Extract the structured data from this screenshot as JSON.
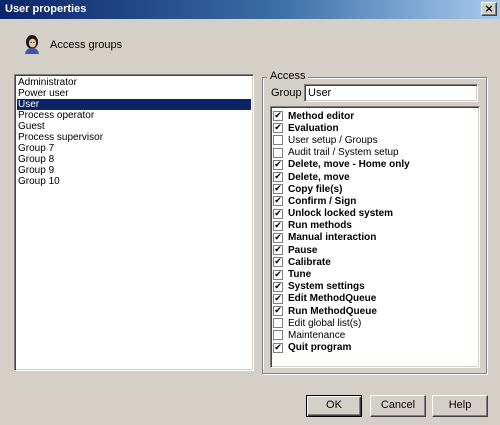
{
  "window": {
    "title": "User properties",
    "close_glyph": "×"
  },
  "header": {
    "icon": "user-icon",
    "label": "Access groups"
  },
  "groups": {
    "items": [
      "Administrator",
      "Power user",
      "User",
      "Process operator",
      "Guest",
      "Process supervisor",
      "Group 7",
      "Group 8",
      "Group 9",
      "Group 10"
    ],
    "selected": "User"
  },
  "access": {
    "legend": "Access",
    "group_label": "Group",
    "group_value": "User",
    "permissions": [
      {
        "label": "Method editor",
        "checked": true
      },
      {
        "label": "Evaluation",
        "checked": true
      },
      {
        "label": "User setup / Groups",
        "checked": false
      },
      {
        "label": "Audit trail / System setup",
        "checked": false
      },
      {
        "label": "Delete, move - Home only",
        "checked": true
      },
      {
        "label": "Delete, move",
        "checked": true
      },
      {
        "label": "Copy file(s)",
        "checked": true
      },
      {
        "label": "Confirm / Sign",
        "checked": true
      },
      {
        "label": "Unlock locked system",
        "checked": true
      },
      {
        "label": "Run methods",
        "checked": true
      },
      {
        "label": "Manual interaction",
        "checked": true
      },
      {
        "label": "Pause",
        "checked": true
      },
      {
        "label": "Calibrate",
        "checked": true
      },
      {
        "label": "Tune",
        "checked": true
      },
      {
        "label": "System settings",
        "checked": true
      },
      {
        "label": "Edit MethodQueue",
        "checked": true
      },
      {
        "label": "Run MethodQueue",
        "checked": true
      },
      {
        "label": "Edit global list(s)",
        "checked": false
      },
      {
        "label": "Maintenance",
        "checked": false
      },
      {
        "label": "Quit program",
        "checked": true
      }
    ]
  },
  "buttons": {
    "ok": "OK",
    "cancel": "Cancel",
    "help": "Help"
  },
  "colors": {
    "selection": "#0a246a",
    "face": "#d4d0c8"
  }
}
